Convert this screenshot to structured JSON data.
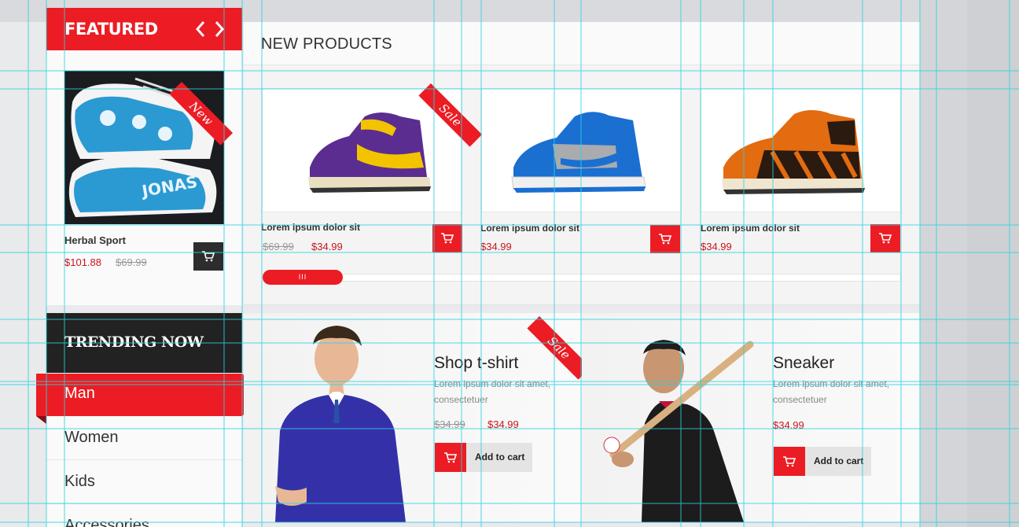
{
  "colors": {
    "accent": "#ec1c24",
    "dark": "#222222",
    "guide": "#2ad4e0"
  },
  "featured": {
    "title": "FEATURED",
    "prev_icon": "chevron-left-icon",
    "next_icon": "chevron-right-icon",
    "badge": "New",
    "product": {
      "name": "Herbal Sport",
      "price": "$101.88",
      "old_price": "$69.99",
      "cart_icon": "cart-icon"
    }
  },
  "new_products": {
    "title": "NEW PRODUCTS",
    "badge": "Sale",
    "items": [
      {
        "name": "Lorem ipsum dolor sit",
        "old_price": "$69.99",
        "price": "$34.99"
      },
      {
        "name": "Lorem ipsum dolor sit",
        "price": "$34.99"
      },
      {
        "name": "Lorem ipsum dolor sit",
        "price": "$34.99"
      }
    ],
    "scroll_grip": "III"
  },
  "trending": {
    "title": "TRENDING NOW",
    "menu": [
      "Man",
      "Women",
      "Kids",
      "Accessories"
    ],
    "active": "Man"
  },
  "promos": [
    {
      "title": "Shop t-shirt",
      "desc": "Lorem ipsum dolor sit amet, consectetuer",
      "old_price": "$34.99",
      "price": "$34.99",
      "button": "Add to cart",
      "badge": "Sale"
    },
    {
      "title": "Sneaker",
      "desc": "Lorem ipsum dolor sit amet, consectetuer",
      "price": "$34.99",
      "button": "Add to cart"
    }
  ]
}
